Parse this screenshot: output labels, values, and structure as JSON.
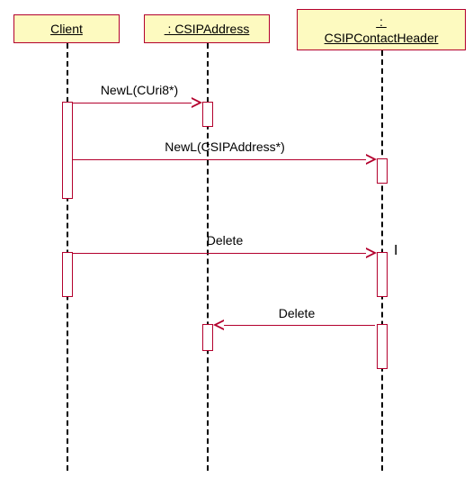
{
  "participants": {
    "client": "Client",
    "csipaddress": " : CSIPAddress",
    "csipcontactheader": " : \nCSIPContactHeader"
  },
  "messages": {
    "m1": "NewL(CUri8*)",
    "m2": "NewL(CSIPAddress*)",
    "m3": "Delete",
    "m4": "Delete"
  }
}
